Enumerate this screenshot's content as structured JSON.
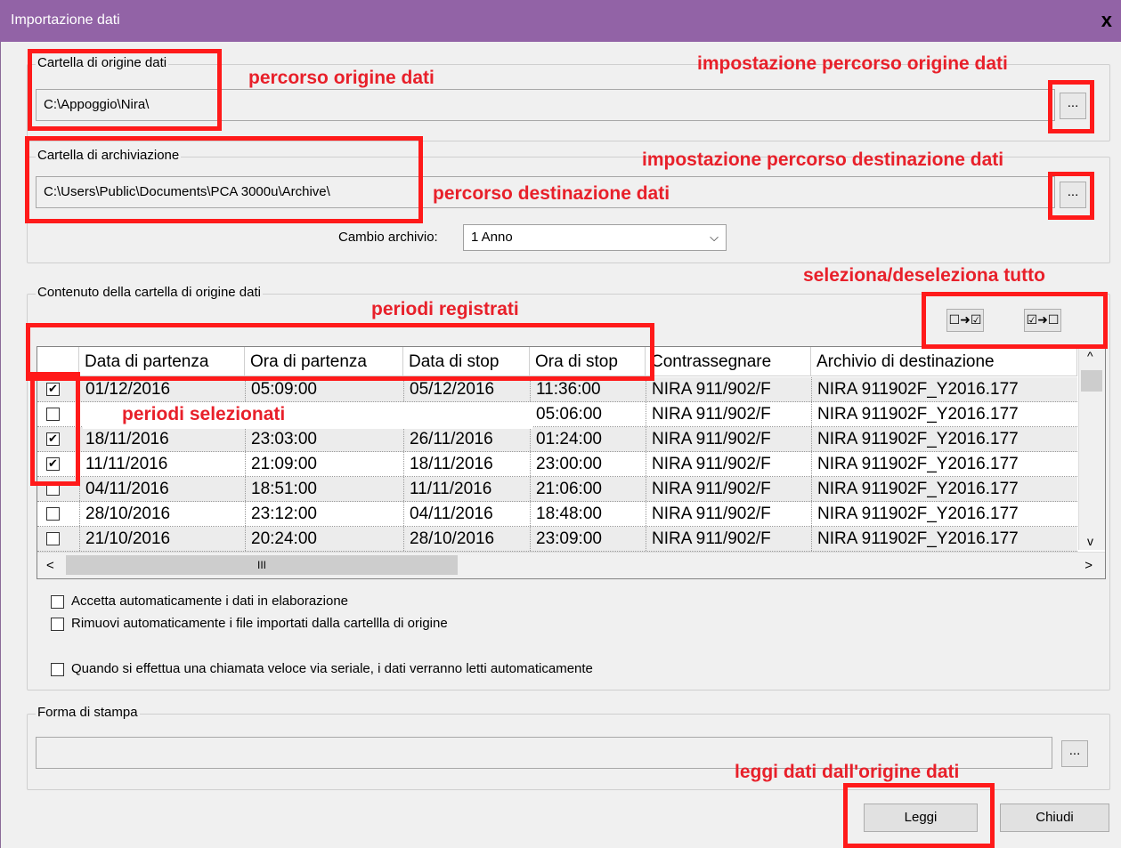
{
  "window": {
    "title": "Importazione dati",
    "close_label": "x"
  },
  "source": {
    "group_label": "Cartella di origine dati",
    "path": "C:\\Appoggio\\Nira\\",
    "browse_label": "..."
  },
  "archive": {
    "group_label": "Cartella di archiviazione",
    "path": "C:\\Users\\Public\\Documents\\PCA 3000u\\Archive\\",
    "browse_label": "...",
    "change_label": "Cambio archivio:",
    "change_value": "1 Anno"
  },
  "content": {
    "group_label": "Contenuto della cartella di origine dati",
    "select_all_label": "☐➜☑",
    "deselect_all_label": "☑➜☐",
    "columns": [
      "Data di partenza",
      "Ora di partenza",
      "Data di stop",
      "Ora di stop",
      "Contrassegnare",
      "Archivio di destinazione"
    ],
    "rows": [
      {
        "checked": "✔",
        "start_date": "01/12/2016",
        "start_time": "05:09:00",
        "stop_date": "05/12/2016",
        "stop_time": "11:36:00",
        "mark": "NIRA 911/902/F",
        "archive": "NIRA 911902F_Y2016.177"
      },
      {
        "checked": "",
        "start_date": "",
        "start_time": "",
        "stop_date": "",
        "stop_time": "05:06:00",
        "mark": "NIRA 911/902/F",
        "archive": "NIRA 911902F_Y2016.177"
      },
      {
        "checked": "✔",
        "start_date": "18/11/2016",
        "start_time": "23:03:00",
        "stop_date": "26/11/2016",
        "stop_time": "01:24:00",
        "mark": "NIRA 911/902/F",
        "archive": "NIRA 911902F_Y2016.177"
      },
      {
        "checked": "✔",
        "start_date": "11/11/2016",
        "start_time": "21:09:00",
        "stop_date": "18/11/2016",
        "stop_time": "23:00:00",
        "mark": "NIRA 911/902/F",
        "archive": "NIRA 911902F_Y2016.177"
      },
      {
        "checked": "",
        "start_date": "04/11/2016",
        "start_time": "18:51:00",
        "stop_date": "11/11/2016",
        "stop_time": "21:06:00",
        "mark": "NIRA 911/902/F",
        "archive": "NIRA 911902F_Y2016.177"
      },
      {
        "checked": "",
        "start_date": "28/10/2016",
        "start_time": "23:12:00",
        "stop_date": "04/11/2016",
        "stop_time": "18:48:00",
        "mark": "NIRA 911/902/F",
        "archive": "NIRA 911902F_Y2016.177"
      },
      {
        "checked": "",
        "start_date": "21/10/2016",
        "start_time": "20:24:00",
        "stop_date": "28/10/2016",
        "stop_time": "23:09:00",
        "mark": "NIRA 911/902/F",
        "archive": "NIRA 911902F_Y2016.177"
      }
    ],
    "scroll_up": "^",
    "scroll_down": "v",
    "scroll_left": "<",
    "scroll_right": ">",
    "scroll_thumb": "III"
  },
  "options": [
    "Accetta automaticamente i dati in elaborazione",
    "Rimuovi automaticamente i file importati dalla cartellla di origine",
    "Quando si effettua una chiamata veloce via seriale, i dati verranno letti automaticamente"
  ],
  "print": {
    "group_label": "Forma di stampa",
    "value": "",
    "browse_label": "..."
  },
  "buttons": {
    "read": "Leggi",
    "close": "Chiudi"
  },
  "annotations": {
    "source_path": "percorso origine dati",
    "source_setting": "impostazione percorso origine dati",
    "dest_setting": "impostazione percorso destinazione dati",
    "dest_path": "percorso destinazione dati",
    "select_all": "seleziona/deseleziona tutto",
    "periods_recorded": "periodi registrati",
    "periods_selected": "periodi selezionati",
    "read_data": "leggi dati dall'origine dati"
  },
  "colors": {
    "titlebar": "#9263a6",
    "annotation": "#e8202a"
  }
}
